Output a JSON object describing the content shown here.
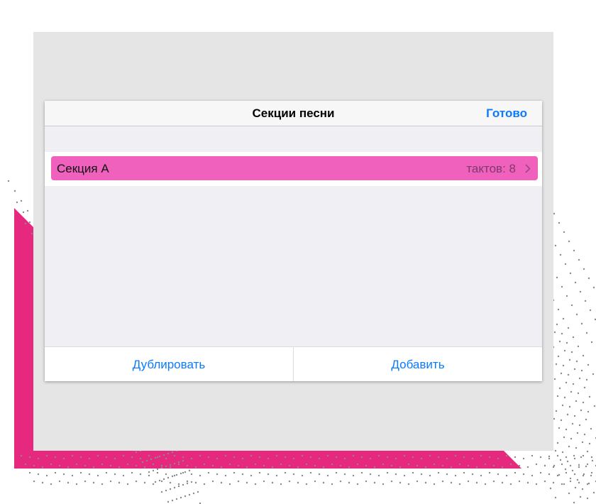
{
  "navbar": {
    "title": "Секции песни",
    "done_label": "Готово"
  },
  "sections": [
    {
      "name": "Секция А",
      "detail": "тактов: 8",
      "color": "#f060bd"
    }
  ],
  "toolbar": {
    "duplicate_label": "Дублировать",
    "add_label": "Добавить"
  },
  "icons": {
    "row_accessory": "chevron-right-icon"
  },
  "colors": {
    "accent": "#0a7aff",
    "decor_pink": "#e6287e",
    "stage_gray": "#e5e5e5"
  }
}
